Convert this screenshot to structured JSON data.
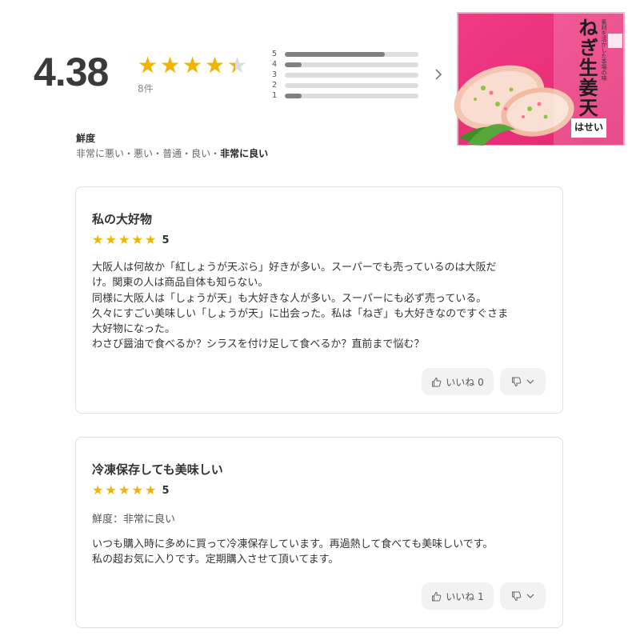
{
  "summary": {
    "average": "4.38",
    "rating_value": 4.38,
    "count_label": "8件",
    "distribution": [
      {
        "label": "5",
        "fraction": 0.75
      },
      {
        "label": "4",
        "fraction": 0.125
      },
      {
        "label": "3",
        "fraction": 0
      },
      {
        "label": "2",
        "fraction": 0
      },
      {
        "label": "1",
        "fraction": 0.125
      }
    ],
    "next_icon": "chevron-right-icon"
  },
  "product": {
    "name": "ねぎ生姜天",
    "tagline": "素材を活かした本場の味",
    "brand": "はせい",
    "colors": {
      "package": "#ee2f7a",
      "brand_box": "#ffffff"
    }
  },
  "freshness": {
    "heading": "鮮度",
    "scale": [
      "非常に悪い",
      "悪い",
      "普通",
      "良い"
    ],
    "separator": "・",
    "selected": "非常に良い"
  },
  "reviews": [
    {
      "title": "私の大好物",
      "rating": "5",
      "body": [
        "大阪人は何故か「紅しょうが天ぷら」好きが多い。スーパーでも売っているのは大阪だ",
        "け。関東の人は商品自体も知らない。",
        "同様に大阪人は「しょうが天」も大好きな人が多い。スーパーにも必ず売っている。",
        "久々にすごい美味しい「しょうが天」に出会った。私は「ねぎ」も大好きなのですぐさま",
        "大好物になった。",
        "わさび醤油で食べるか？シラスを付け足して食べるか？直前まで悩む？"
      ],
      "like_label": "いいね 0",
      "like_icon": "thumbs-up-icon",
      "dislike_icon": "thumbs-down-icon"
    },
    {
      "title": "冷凍保存しても美味しい",
      "rating": "5",
      "freshness": "鮮度：非常に良い",
      "body": [
        "いつも購入時に多めに買って冷凍保存しています。再過熱して食べても美味しいです。",
        "私の超お気に入りです。定期購入させて頂いてます。"
      ],
      "like_label": "いいね 1",
      "like_icon": "thumbs-up-icon",
      "dislike_icon": "thumbs-down-icon"
    }
  ],
  "colors": {
    "star": "#f0b400",
    "star_empty": "#dcdcdc",
    "bar_fill": "#808080",
    "bar_bg": "#dddddd"
  }
}
